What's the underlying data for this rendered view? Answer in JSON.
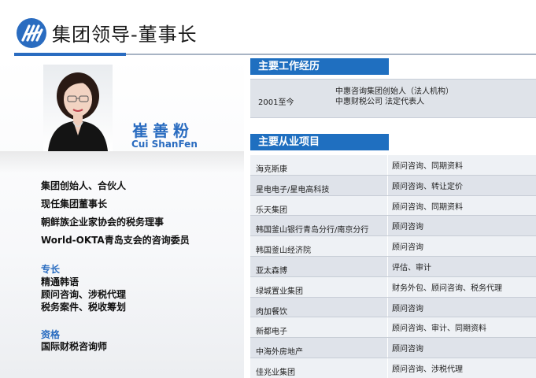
{
  "header": {
    "title": "集团领导-董事长",
    "brand_color": "#2a6cc0"
  },
  "profile": {
    "name_cn": "崔善粉",
    "name_en": "Cui ShanFen",
    "titles": [
      "集团创始人、合伙人",
      "现任集团董事长",
      "朝鲜族企业家协会的税务理事",
      "World-OKTA青岛支会的咨询委员"
    ],
    "specialty_label": "专长",
    "specialties": [
      "精通韩语",
      "顾问咨询、涉税代理",
      "税务案件、税收筹划"
    ],
    "qualification_label": "资格",
    "qualifications": [
      "国际财税咨询师"
    ]
  },
  "work": {
    "header": "主要工作经历",
    "year": "2001至今",
    "desc_line1": "中惠咨询集团创始人（法人机构）",
    "desc_line2": "中惠财税公司 法定代表人"
  },
  "projects": {
    "header": "主要从业项目",
    "rows": [
      {
        "client": "海克斯康",
        "service": "顾问咨询、同期资料"
      },
      {
        "client": "星电电子/星电高科技",
        "service": "顾问咨询、转让定价"
      },
      {
        "client": "乐天集团",
        "service": "顾问咨询、同期资料"
      },
      {
        "client": "韩国釜山银行青岛分行/南京分行",
        "service": "顾问咨询"
      },
      {
        "client": "韩国釜山经济院",
        "service": "顾问咨询"
      },
      {
        "client": "亚太森博",
        "service": "评估、审计"
      },
      {
        "client": "绿城置业集团",
        "service": "财务外包、顾问咨询、税务代理"
      },
      {
        "client": "肉加餐饮",
        "service": "顾问咨询"
      },
      {
        "client": "新都电子",
        "service": "顾问咨询、审计、同期资料"
      },
      {
        "client": "中海外房地产",
        "service": "顾问咨询"
      },
      {
        "client": "佳兆业集团",
        "service": "顾问咨询、涉税代理"
      }
    ]
  }
}
